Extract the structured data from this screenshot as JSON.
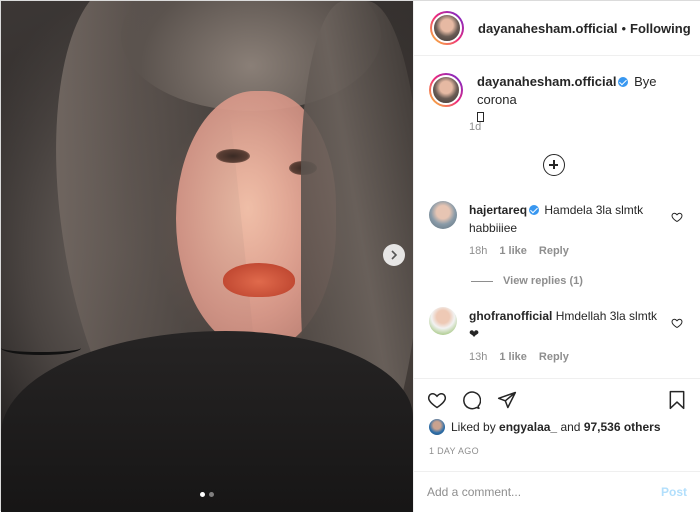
{
  "post": {
    "author": "dayanahesham.official",
    "follow_state": "Following",
    "separator": "•",
    "slides_total": 2,
    "slide_active": 1
  },
  "caption": {
    "username": "dayanahesham.official",
    "text": "Bye corona",
    "emoji": "⁣",
    "time": "1d"
  },
  "comments": [
    {
      "username": "hajertareq",
      "verified": true,
      "text": "Hamdela 3la slmtk habbiiiee",
      "time": "18h",
      "likes": "1 like",
      "reply_label": "Reply",
      "view_replies": "View replies (1)"
    },
    {
      "username": "ghofranofficial",
      "verified": false,
      "text": "Hmdellah 3la slmtk ❤",
      "time": "13h",
      "likes": "1 like",
      "reply_label": "Reply"
    }
  ],
  "likes": {
    "prefix": "Liked by",
    "user": "engyalaa_",
    "and": "and",
    "others": "97,536 others"
  },
  "posted_ago": "1 DAY AGO",
  "comment_box": {
    "placeholder": "Add a comment...",
    "post_label": "Post"
  },
  "colors": {
    "accent": "#3897f0",
    "post_disabled": "#b2dffc",
    "muted": "#8e8e8e",
    "text": "#262626"
  },
  "icons": [
    "chevron-right-icon",
    "plus-circle-icon",
    "heart-icon",
    "comment-icon",
    "share-icon",
    "bookmark-icon",
    "verified-badge-icon"
  ]
}
